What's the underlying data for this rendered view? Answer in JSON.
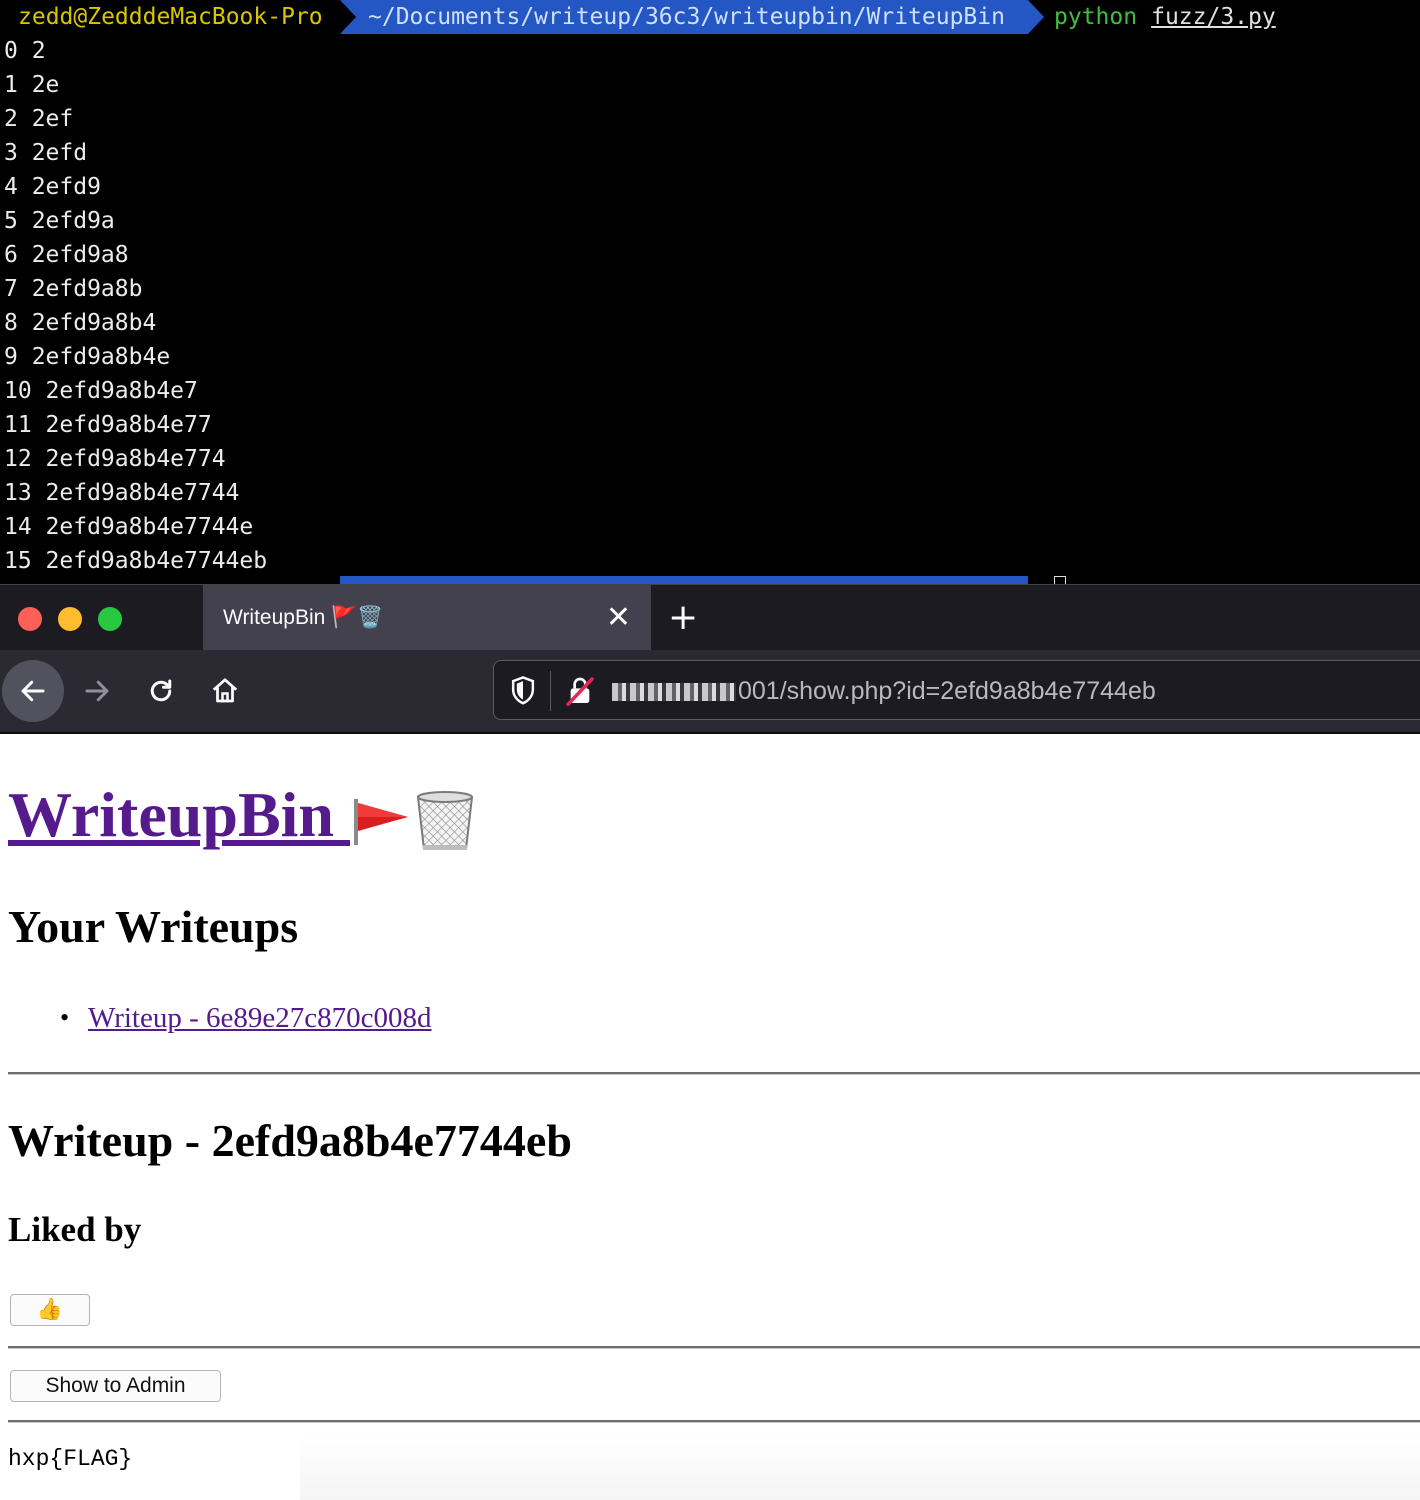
{
  "terminal": {
    "prompt_user": "zedd@ZedddeMacBook-Pro",
    "prompt_path": "~/Documents/writeup/36c3/writeupbin/WriteupBin",
    "command": "python",
    "command_arg": "fuzz/3.py",
    "output": [
      "0 2",
      "1 2e",
      "2 2ef",
      "3 2efd",
      "4 2efd9",
      "5 2efd9a",
      "6 2efd9a8",
      "7 2efd9a8b",
      "8 2efd9a8b4",
      "9 2efd9a8b4e",
      "10 2efd9a8b4e7",
      "11 2efd9a8b4e77",
      "12 2efd9a8b4e774",
      "13 2efd9a8b4e7744",
      "14 2efd9a8b4e7744e",
      "15 2efd9a8b4e7744eb"
    ]
  },
  "browser": {
    "tab_title": "WriteupBin 🚩🗑️",
    "tab_close": "✕",
    "new_tab": "+",
    "url_visible": "001/show.php?id=2efd9a8b4e7744eb",
    "icons": [
      "back-arrow-icon",
      "forward-arrow-icon",
      "reload-icon",
      "home-icon",
      "shield-icon",
      "insecure-lock-icon"
    ]
  },
  "page": {
    "site_title": "WriteupBin",
    "your_writeups_heading": "Your Writeups",
    "writeups": [
      {
        "label": "Writeup - 6e89e27c870c008d"
      }
    ],
    "writeup_heading": "Writeup - 2efd9a8b4e7744eb",
    "liked_by_heading": "Liked by",
    "like_button": "👍",
    "show_admin_button": "Show to Admin",
    "flag": "hxp{FLAG}"
  },
  "colors": {
    "link_visited": "#551a8b",
    "path_segment": "#2456c4",
    "prompt_user": "#d7c600",
    "python_cmd": "#3fbf3f"
  }
}
